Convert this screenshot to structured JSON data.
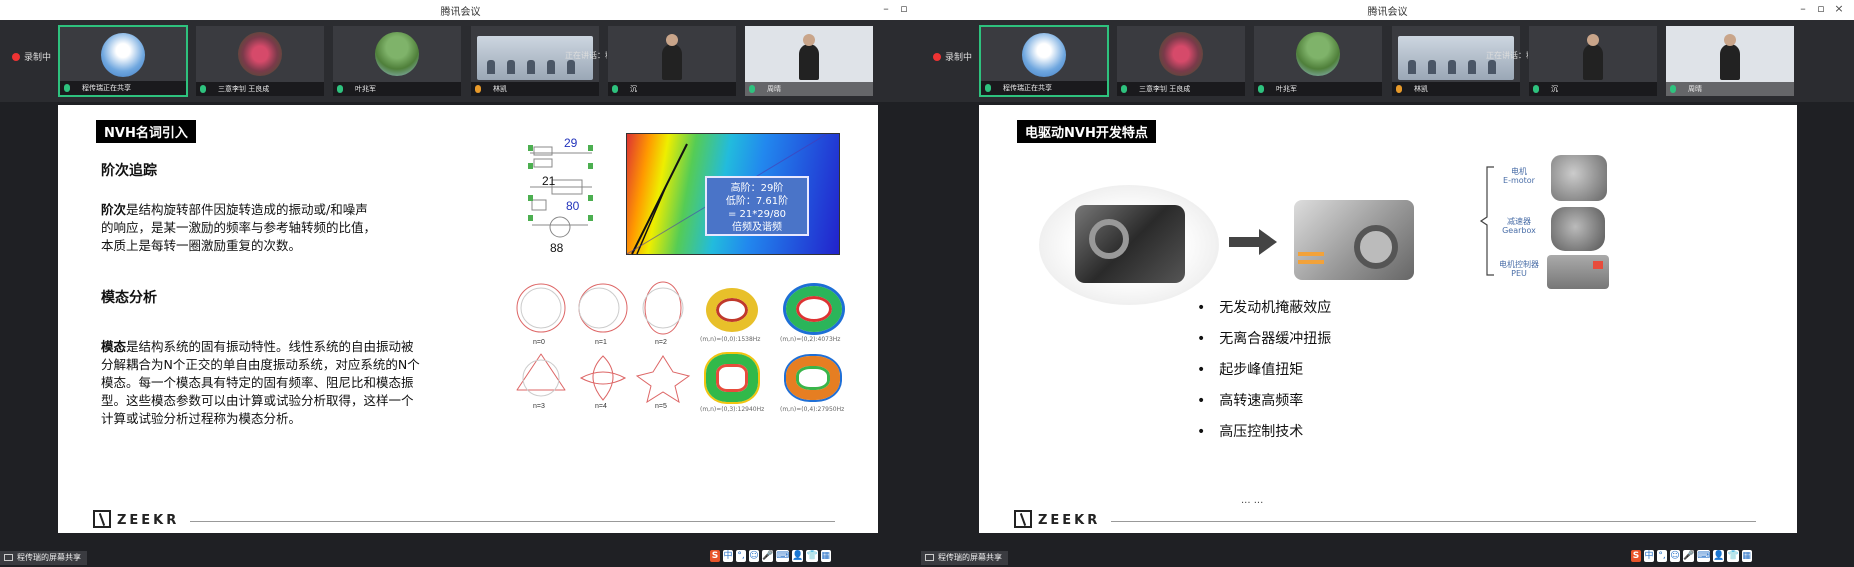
{
  "app_title": "腾讯会议",
  "left": {
    "recording_label": "录制中",
    "speaking": "正在讲话：程传瑞；林凯；",
    "participants": [
      {
        "name": "程传瑞正在共享",
        "active": true
      },
      {
        "name": "三意李钊 王良成",
        "active": false
      },
      {
        "name": "叶兆军",
        "active": false
      },
      {
        "name": "林凯",
        "active": false
      },
      {
        "name": "沉",
        "active": false
      },
      {
        "name": "周晴",
        "active": false
      }
    ],
    "slide": {
      "title": "NVH名词引入",
      "s1_heading": "阶次追踪",
      "s1_bold": "阶次",
      "s1_line1": "是结构旋转部件因旋转造成的振动或/和噪声",
      "s1_line2": "的响应，是某一激励的频率与参考轴转频的比值，",
      "s1_line3": "本质上是每转一圈激励重复的次数。",
      "s2_heading": "模态分析",
      "s2_bold": "模态",
      "s2_line1": "是结构系统的固有振动特性。线性系统的自由振动被",
      "s2_line2": "分解耦合为N个正交的单自由度振动系统，对应系统的N个",
      "s2_line3": "模态。每一个模态具有特定的固有频率、阻尼比和模态振",
      "s2_line4": "型。这些模态参数可以由计算或试验分析取得，这样一个",
      "s2_line5": "计算或试验分析过程称为模态分析。",
      "gear_labels": [
        "29",
        "21",
        "80",
        "88"
      ],
      "callout": [
        "高阶：29阶",
        "低阶：7.61阶",
        "= 21*29/80",
        "倍频及谐频"
      ],
      "mode_labels": [
        "n=0",
        "n=1",
        "n=2",
        "n=3",
        "n=4",
        "n=5"
      ],
      "mode_captions": [
        "(m,n)=(0,0):1538Hz",
        "(m,n)=(0,2):4073Hz",
        "(m,n)=(0,3):12940Hz",
        "(m,n)=(0,4):27950Hz"
      ],
      "brand": "ZEEKR"
    },
    "share_label": "程传瑞的屏幕共享"
  },
  "right": {
    "recording_label": "录制中",
    "speaking": "正在讲话：程传瑞；林凯；",
    "participants": [
      {
        "name": "程传瑞正在共享",
        "active": true
      },
      {
        "name": "三意李钊 王良成",
        "active": false
      },
      {
        "name": "叶兆军",
        "active": false
      },
      {
        "name": "林凯",
        "active": false
      },
      {
        "name": "沉",
        "active": false
      },
      {
        "name": "周晴",
        "active": false
      }
    ],
    "slide": {
      "title": "电驱动NVH开发特点",
      "bullets": [
        "无发动机掩蔽效应",
        "无离合器缓冲扭振",
        "起步峰值扭矩",
        "高转速高频率",
        "高压控制技术"
      ],
      "ellipsis": "... ...",
      "component_labels": [
        {
          "cn": "电机",
          "en": "E-motor"
        },
        {
          "cn": "减速器",
          "en": "Gearbox"
        },
        {
          "cn": "电机控制器",
          "en": "PEU"
        }
      ],
      "brand": "ZEEKR"
    },
    "share_label": "程传瑞的屏幕共享"
  },
  "ime": [
    "S",
    "中",
    "°,",
    "☺",
    "🎤",
    "⌨",
    "👤",
    "👕",
    "▦"
  ],
  "colors": {
    "accent": "#2ec27e",
    "titlebar": "#ffffff",
    "toolbar": "#2b2c30",
    "slide_title_bg": "#000000"
  }
}
